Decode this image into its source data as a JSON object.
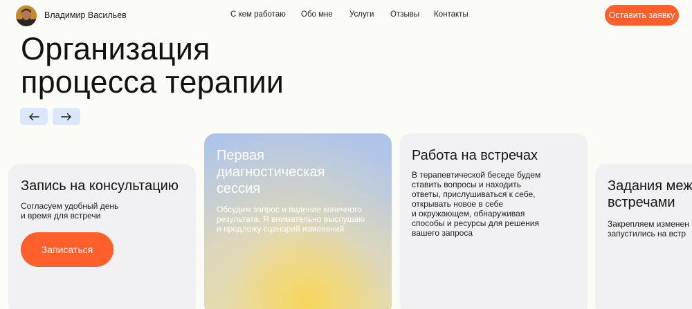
{
  "header": {
    "owner_name": "Владимир Васильев",
    "nav": [
      {
        "label": "С кем работаю"
      },
      {
        "label": "Обо мне"
      },
      {
        "label": "Услуги"
      },
      {
        "label": "Отзывы"
      },
      {
        "label": "Контакты"
      }
    ],
    "cta_label": "Оставить заявку"
  },
  "section": {
    "title_lines": [
      "Организация",
      "процесса терапии"
    ],
    "prev_icon": "arrow-left-icon",
    "next_icon": "arrow-right-icon"
  },
  "cards": [
    {
      "title_lines": [
        "Запись на консультацию"
      ],
      "text_lines": [
        "Согласуем удобный день",
        "и время для встречи"
      ],
      "button_label": "Записаться"
    },
    {
      "title_lines": [
        "Первая",
        "диагностическая",
        "сессия"
      ],
      "text_lines": [
        "Обсудим запрос и видение конечного",
        "результата. Я внимательно выслушаю",
        "и предложу сценарий изменений"
      ]
    },
    {
      "title_lines": [
        "Работа на встречах"
      ],
      "text_lines": [
        "В терапевтической беседе будем",
        "ставить вопросы и находить",
        "ответы, прислушиваться к себе,",
        "открывать новое в себе",
        "и окружающем, обнаруживая",
        "способы и ресурсы для решения",
        "вашего запроса"
      ]
    },
    {
      "title_lines": [
        "Задания меж",
        "встречами"
      ],
      "text_lines": [
        "Закрепляем изменен",
        "запустились на встр"
      ]
    }
  ],
  "colors": {
    "accent": "#fe5f2b",
    "arrow_bg": "#dbe8fb",
    "card_bg": "#f1f1f3",
    "page_bg": "#fbfbf7"
  }
}
